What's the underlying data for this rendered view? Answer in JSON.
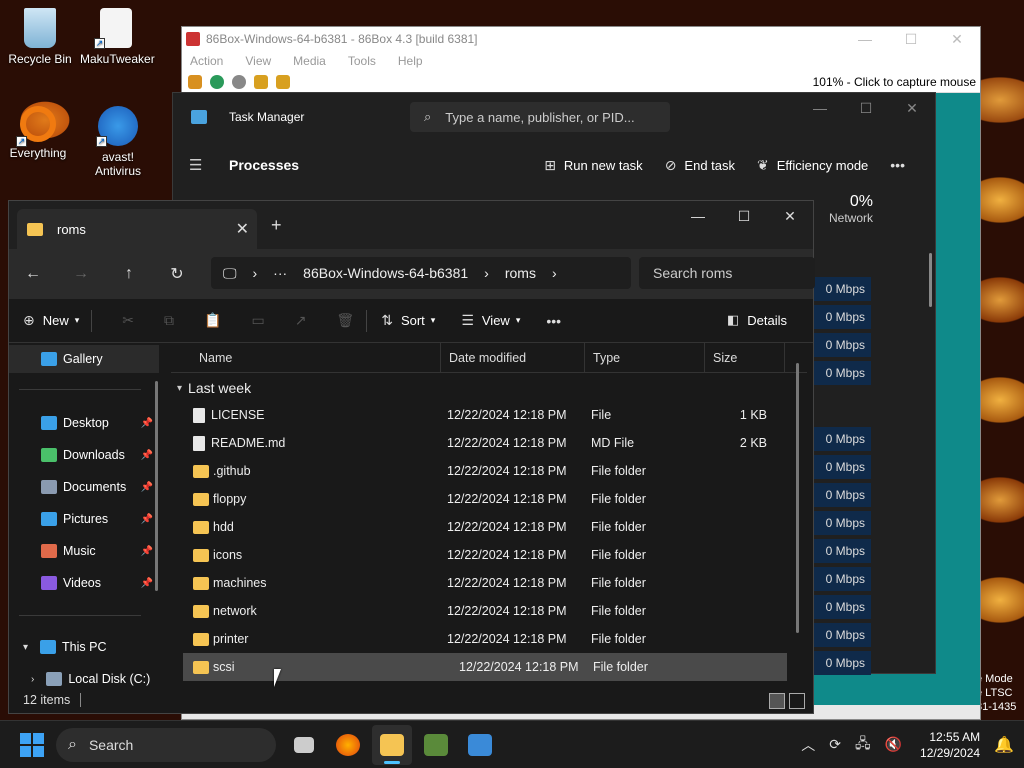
{
  "desktop": {
    "icons": [
      {
        "label": "Recycle Bin",
        "icon": "recycle-bin-icon"
      },
      {
        "label": "MakuTweaker",
        "icon": "document-icon"
      },
      {
        "label": "Everything",
        "icon": "everything-search-icon"
      },
      {
        "label": "avast! Antivirus",
        "icon": "avast-icon"
      }
    ],
    "watermark": [
      "e Mode",
      "e LTSC",
      "31-1435"
    ]
  },
  "vm_window": {
    "title": "86Box-Windows-64-b6381 - 86Box 4.3 [build 6381]",
    "menu": [
      "Action",
      "View",
      "Media",
      "Tools",
      "Help"
    ],
    "capture_text": "101% - Click to capture mouse"
  },
  "task_manager": {
    "title": "Task Manager",
    "search_placeholder": "Type a name, publisher, or PID...",
    "page_title": "Processes",
    "actions": {
      "run_new_task": "Run new task",
      "end_task": "End task",
      "efficiency_mode": "Efficiency mode"
    },
    "network_header": {
      "percent": "0%",
      "label": "Network"
    },
    "network_values": [
      "0 Mbps",
      "0 Mbps",
      "0 Mbps",
      "0 Mbps",
      "0 Mbps",
      "0 Mbps",
      "0 Mbps",
      "0 Mbps",
      "0 Mbps",
      "0 Mbps",
      "0 Mbps",
      "0 Mbps",
      "0 Mbps",
      "0 Mbps"
    ]
  },
  "explorer": {
    "tab_title": "roms",
    "breadcrumb": [
      "86Box-Windows-64-b6381",
      "roms"
    ],
    "search_placeholder": "Search roms",
    "commands": {
      "new": "New",
      "sort": "Sort",
      "view": "View",
      "details": "Details"
    },
    "sidebar": {
      "gallery": "Gallery",
      "quick_access": [
        {
          "label": "Desktop",
          "color": "#3aa0e8"
        },
        {
          "label": "Downloads",
          "color": "#4ac06a"
        },
        {
          "label": "Documents",
          "color": "#8a9ab0"
        },
        {
          "label": "Pictures",
          "color": "#3aa0e8"
        },
        {
          "label": "Music",
          "color": "#e06a4a"
        },
        {
          "label": "Videos",
          "color": "#8a5ae0"
        }
      ],
      "this_pc": "This PC",
      "local_disk": "Local Disk (C:)"
    },
    "columns": {
      "name": "Name",
      "date_modified": "Date modified",
      "type": "Type",
      "size": "Size"
    },
    "group": "Last week",
    "files": [
      {
        "name": "LICENSE",
        "modified": "12/22/2024 12:18 PM",
        "type": "File",
        "size": "1 KB",
        "kind": "file"
      },
      {
        "name": "README.md",
        "modified": "12/22/2024 12:18 PM",
        "type": "MD File",
        "size": "2 KB",
        "kind": "file"
      },
      {
        "name": ".github",
        "modified": "12/22/2024 12:18 PM",
        "type": "File folder",
        "size": "",
        "kind": "folder"
      },
      {
        "name": "floppy",
        "modified": "12/22/2024 12:18 PM",
        "type": "File folder",
        "size": "",
        "kind": "folder"
      },
      {
        "name": "hdd",
        "modified": "12/22/2024 12:18 PM",
        "type": "File folder",
        "size": "",
        "kind": "folder"
      },
      {
        "name": "icons",
        "modified": "12/22/2024 12:18 PM",
        "type": "File folder",
        "size": "",
        "kind": "folder"
      },
      {
        "name": "machines",
        "modified": "12/22/2024 12:18 PM",
        "type": "File folder",
        "size": "",
        "kind": "folder"
      },
      {
        "name": "network",
        "modified": "12/22/2024 12:18 PM",
        "type": "File folder",
        "size": "",
        "kind": "folder"
      },
      {
        "name": "printer",
        "modified": "12/22/2024 12:18 PM",
        "type": "File folder",
        "size": "",
        "kind": "folder"
      },
      {
        "name": "scsi",
        "modified": "12/22/2024 12:18 PM",
        "type": "File folder",
        "size": "",
        "kind": "folder",
        "selected": true
      }
    ],
    "status": "12 items"
  },
  "taskbar": {
    "search_label": "Search",
    "apps": [
      "task-view-icon",
      "firefox-icon",
      "file-explorer-icon",
      "86box-icon",
      "task-manager-icon"
    ],
    "time": "12:55 AM",
    "date": "12/29/2024"
  },
  "colors": {
    "folder": "#f5c453",
    "file": "#e8e8e8",
    "accent": "#4cc2ff",
    "vm_screen": "#0f8a8a"
  }
}
